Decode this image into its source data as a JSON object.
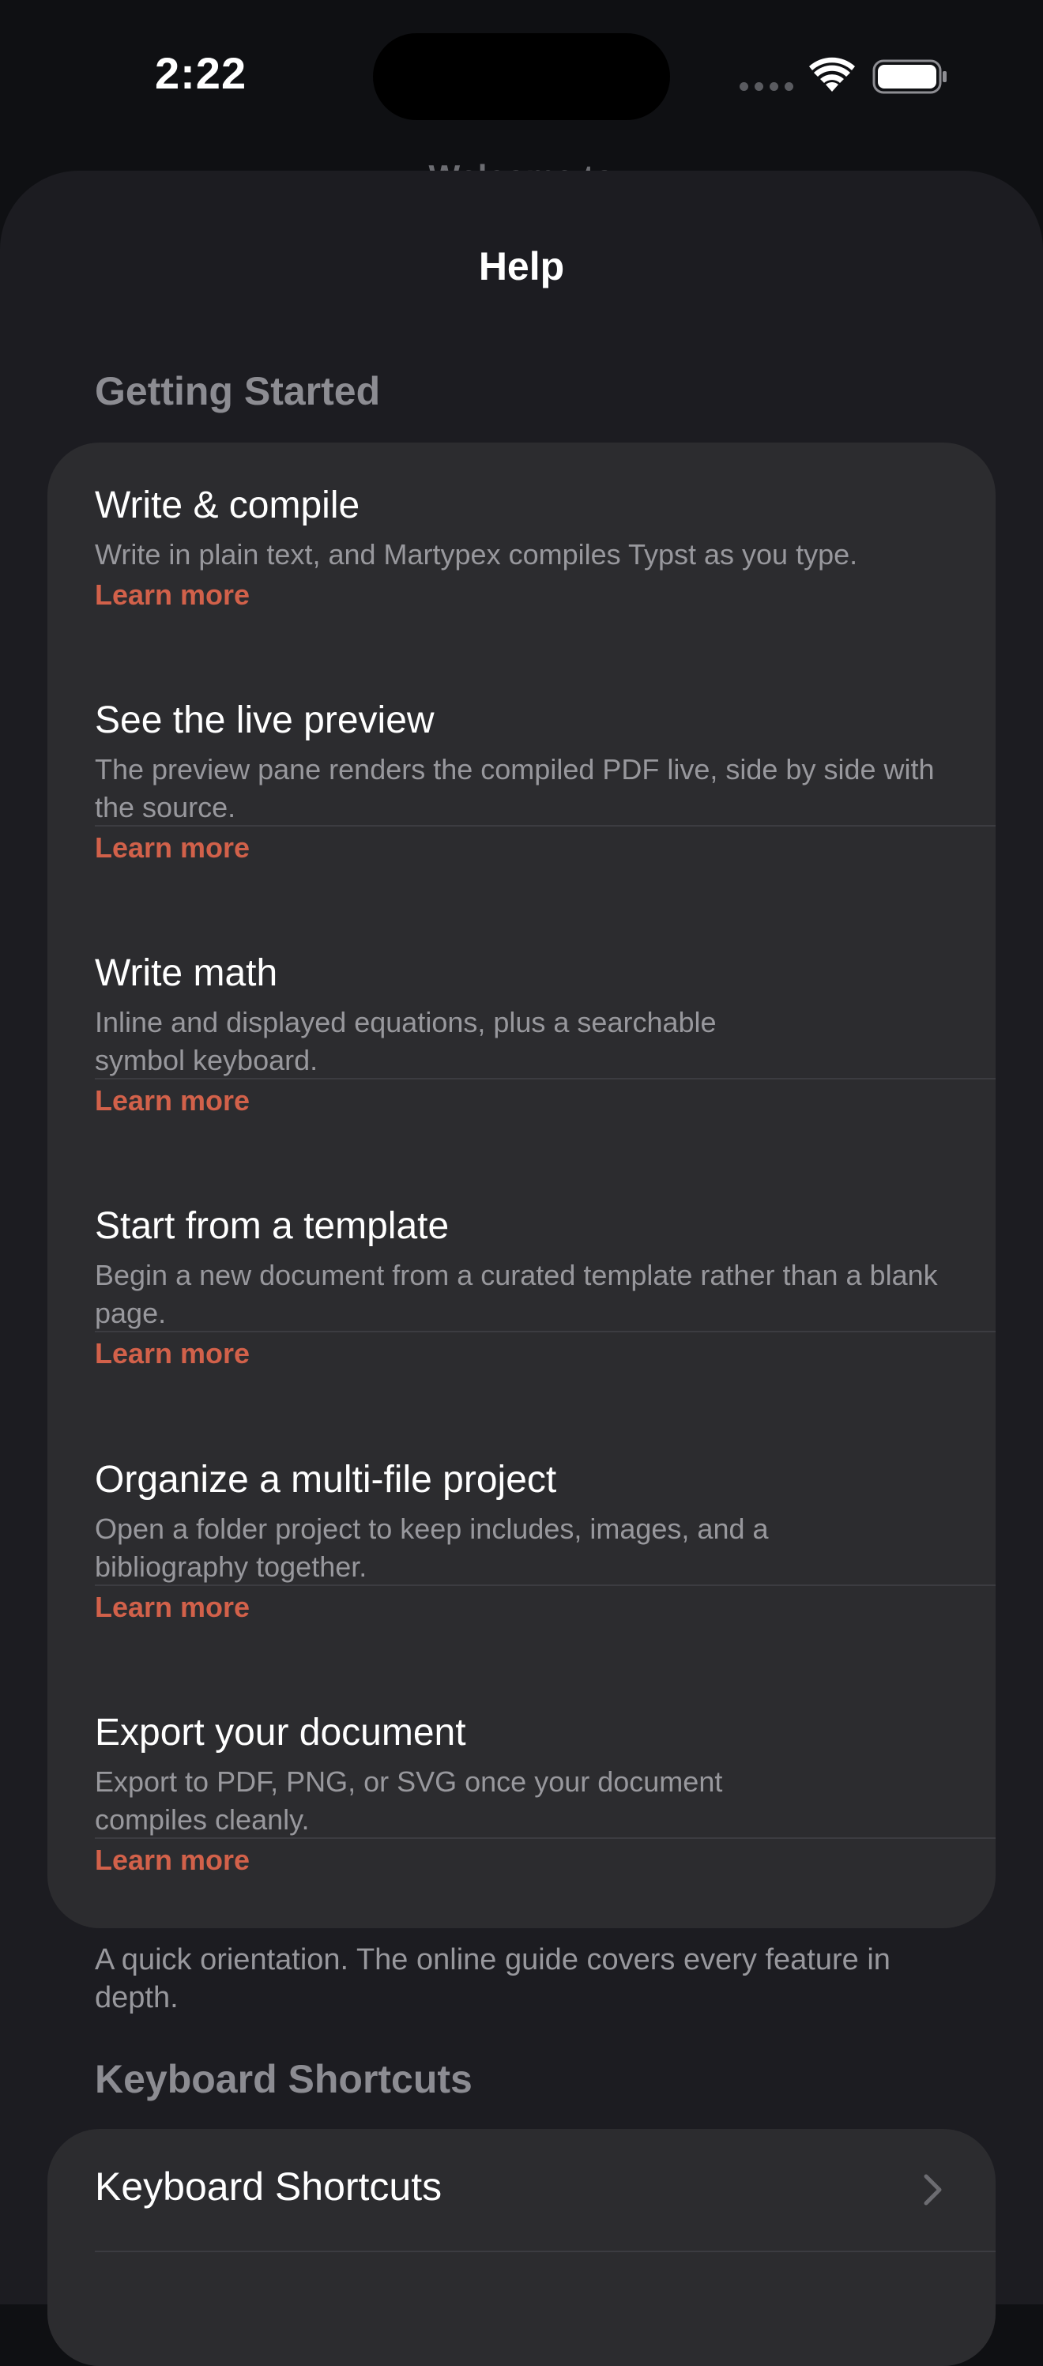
{
  "status_bar": {
    "time": "2:22"
  },
  "behind": {
    "title": "Welcome to"
  },
  "sheet": {
    "title": "Help"
  },
  "getting_started": {
    "header": "Getting Started",
    "items": [
      {
        "title": "Write & compile",
        "description": "Write in plain text, and Martypex compiles Typst as you type.",
        "link": "Learn more"
      },
      {
        "title": "See the live preview",
        "description": "The preview pane renders the compiled PDF live, side by side with the source.",
        "link": "Learn more"
      },
      {
        "title": "Write math",
        "description": "Inline and displayed equations, plus a searchable symbol keyboard.",
        "link": "Learn more"
      },
      {
        "title": "Start from a template",
        "description": "Begin a new document from a curated template rather than a blank page.",
        "link": "Learn more"
      },
      {
        "title": "Organize a multi-file project",
        "description": "Open a folder project to keep includes, images, and a bibliography together.",
        "link": "Learn more"
      },
      {
        "title": "Export your document",
        "description": "Export to PDF, PNG, or SVG once your document compiles cleanly.",
        "link": "Learn more"
      }
    ],
    "footer": "A quick orientation. The online guide covers every feature in depth."
  },
  "keyboard_shortcuts": {
    "header": "Keyboard Shortcuts",
    "row_label": "Keyboard Shortcuts",
    "row_icon": "chevron-right-icon"
  },
  "colors": {
    "accent": "#d2614a",
    "background": "#0f1013",
    "sheet": "#1c1c21",
    "card": "#2c2c2f"
  }
}
